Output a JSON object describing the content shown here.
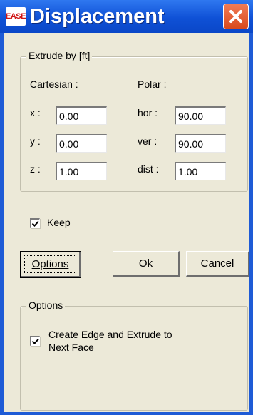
{
  "window": {
    "title": "Displacement",
    "app_icon_text": "EASE",
    "icons": {
      "app": "ease-logo-icon",
      "close": "close-icon"
    },
    "colors": {
      "titlebar": "#0f51d6",
      "close": "#d94a1e",
      "client": "#ece9d8"
    }
  },
  "extrude": {
    "group_label": "Extrude by [ft]",
    "cartesian": {
      "heading": "Cartesian :",
      "x_label": "x :",
      "x_value": "0.00",
      "y_label": "y :",
      "y_value": "0.00",
      "z_label": "z :",
      "z_value": "1.00"
    },
    "polar": {
      "heading": "Polar :",
      "hor_label": "hor :",
      "hor_value": "90.00",
      "ver_label": "ver :",
      "ver_value": "90.00",
      "dist_label": "dist :",
      "dist_value": "1.00"
    }
  },
  "keep": {
    "label": "Keep",
    "checked": true
  },
  "buttons": {
    "options_label": "Options",
    "ok_label": "Ok",
    "cancel_label": "Cancel"
  },
  "options_group": {
    "label": "Options",
    "create_edge_line1": "Create Edge and Extrude to",
    "create_edge_line2": "Next Face",
    "checked": true
  }
}
